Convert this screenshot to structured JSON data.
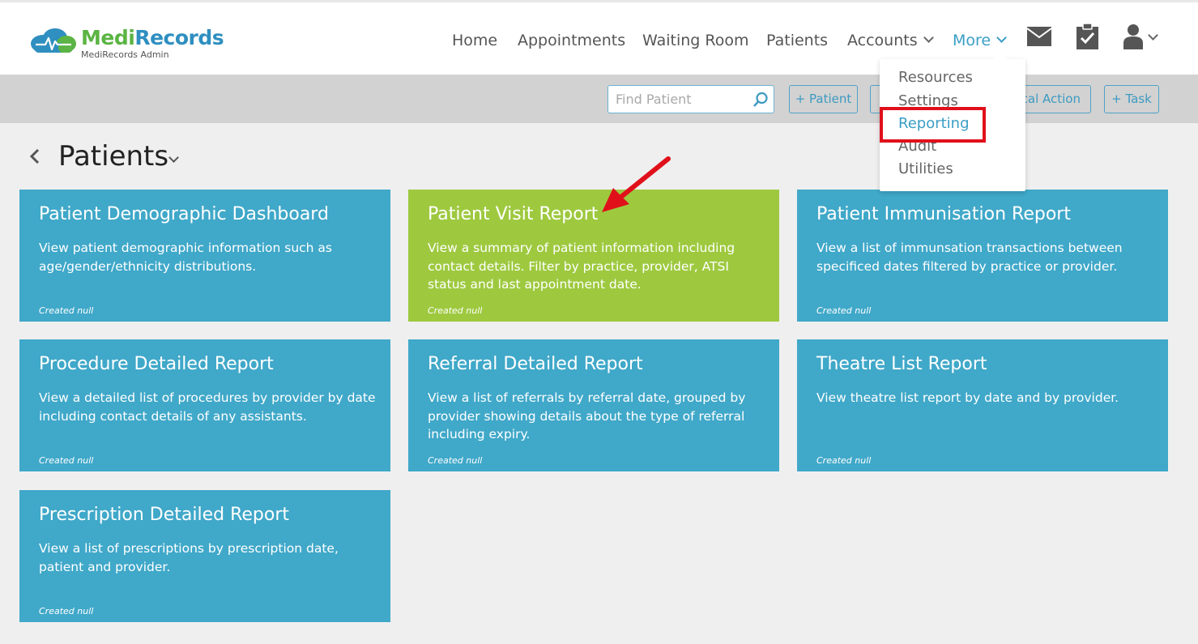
{
  "app": {
    "logo_medi": "Medi",
    "logo_records": "Records",
    "logo_sub": "MediRecords Admin"
  },
  "nav": {
    "home": "Home",
    "appointments": "Appointments",
    "waiting_room": "Waiting Room",
    "patients": "Patients",
    "accounts": "Accounts",
    "more": "More"
  },
  "icons": {
    "mail": "mail-icon",
    "tasks": "clipboard-check-icon",
    "user": "user-icon",
    "search": "search-icon",
    "back": "chevron-left-icon"
  },
  "toolbar": {
    "search_placeholder": "Find Patient",
    "add_patient": "+ Patient",
    "hidden_button": "",
    "clinical_action": "ical Action",
    "add_task": "+ Task"
  },
  "more_menu": {
    "items": [
      "Resources",
      "Settings",
      "Reporting",
      "Audit",
      "Utilities"
    ],
    "highlighted": "Reporting"
  },
  "page": {
    "title": "Patients"
  },
  "cards": [
    {
      "title": "Patient Demographic Dashboard",
      "description": "View patient demographic information such as age/gender/ethnicity distributions.",
      "created": "Created null"
    },
    {
      "title": "Patient Visit Report",
      "description": "View a summary of patient information including contact details. Filter by practice, provider, ATSI status and last appointment date.",
      "created": "Created null"
    },
    {
      "title": "Patient Immunisation Report",
      "description": "View a list of immunsation transactions between specificed dates filtered by practice or provider.",
      "created": "Created null"
    },
    {
      "title": "Procedure Detailed Report",
      "description": "View a detailed list of procedures by provider by date including contact details of any assistants.",
      "created": "Created null"
    },
    {
      "title": "Referral Detailed Report",
      "description": "View a list of referrals by referral date, grouped by provider showing details about the type of referral including expiry.",
      "created": "Created null"
    },
    {
      "title": "Theatre List Report",
      "description": "View theatre list report by date and by provider.",
      "created": "Created null"
    },
    {
      "title": "Prescription Detailed Report",
      "description": "View a list of prescriptions by prescription date, patient and provider.",
      "created": "Created null"
    }
  ],
  "colors": {
    "card_blue": "#40a8c9",
    "card_green": "#9ec93f",
    "accent": "#3a9ec5",
    "highlight_red": "#e0101b",
    "logo_green": "#5bb443",
    "logo_blue": "#2f8fc0"
  }
}
